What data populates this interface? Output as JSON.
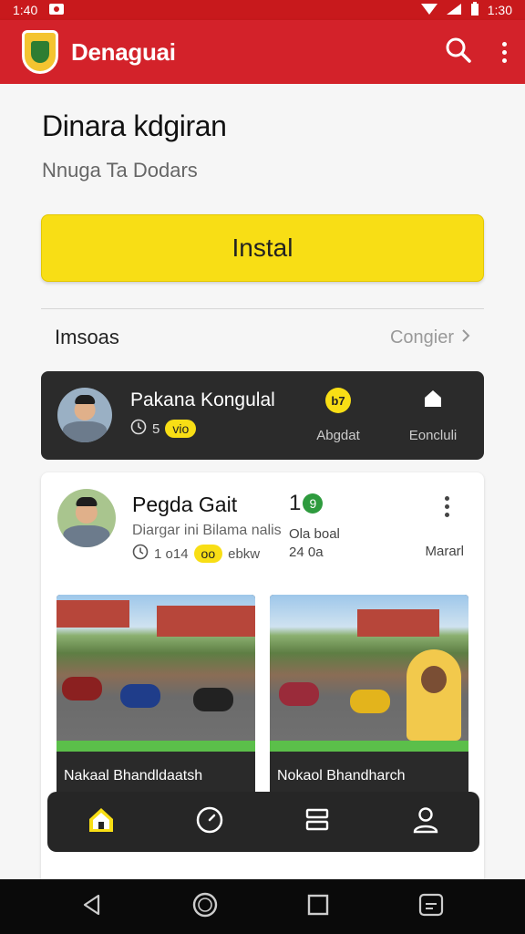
{
  "status_bar": {
    "time": "1:40",
    "right_time": "1:30"
  },
  "app_bar": {
    "title": "Denaguai"
  },
  "hero": {
    "headline": "Dinara kdgiran",
    "subheadline": "Nnuga Ta Dodars",
    "install_label": "Instal"
  },
  "section": {
    "title": "Imsoas",
    "link_label": "Congier"
  },
  "dark_card": {
    "name": "Pakana Kongulal",
    "meta_count": "5",
    "badge": "vio",
    "action_one": {
      "icon_text": "b7",
      "label": "Abgdat"
    },
    "action_two": {
      "label": "Eoncluli"
    }
  },
  "post": {
    "name": "Pegda Gait",
    "subtitle": "Diargar ini Bilama nalis",
    "meta_time": "1 o14",
    "badge": "oo",
    "meta_suffix": "ebkw",
    "stat_number": "1",
    "stat_badge": "9",
    "stat_line1": "Ola boal",
    "stat_line2": "24 0a",
    "more_label": "Mararl",
    "images": [
      {
        "caption": "Nakaal Bhandldaatsh"
      },
      {
        "caption": "Nokaol Bhandharch"
      }
    ]
  },
  "bottom_nav": {
    "items": [
      "home",
      "explore",
      "list",
      "profile"
    ]
  },
  "colors": {
    "brand_red": "#d3222a",
    "accent_yellow": "#f8de15",
    "dark_card": "#2b2b2b",
    "green": "#2e9b3e"
  }
}
